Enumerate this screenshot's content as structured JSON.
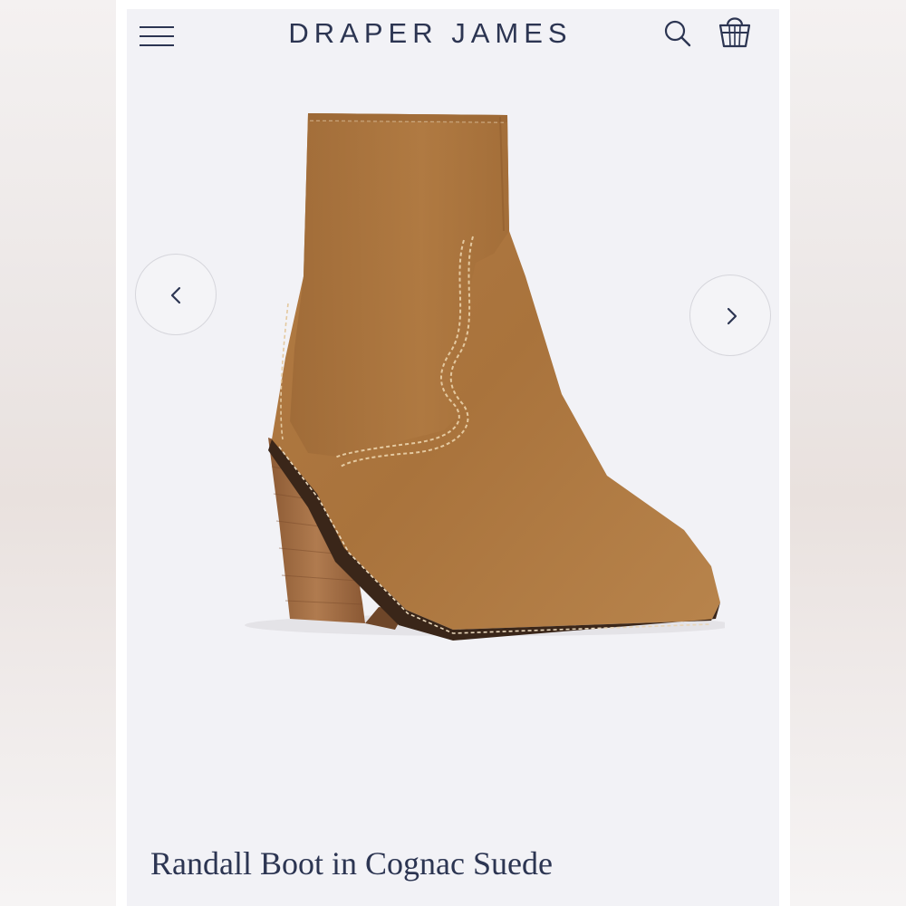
{
  "header": {
    "brand": "DRAPER JAMES",
    "menu_icon": "hamburger-menu-icon",
    "search_icon": "search-icon",
    "bag_icon": "shopping-bag-icon"
  },
  "gallery": {
    "prev_icon": "chevron-left-icon",
    "next_icon": "chevron-right-icon",
    "image_subject": "ankle boot"
  },
  "product": {
    "title": "Randall Boot in Cognac Suede"
  },
  "colors": {
    "brand_navy": "#2c3552",
    "suede": "#b07a42",
    "background": "#f2f2f6"
  }
}
